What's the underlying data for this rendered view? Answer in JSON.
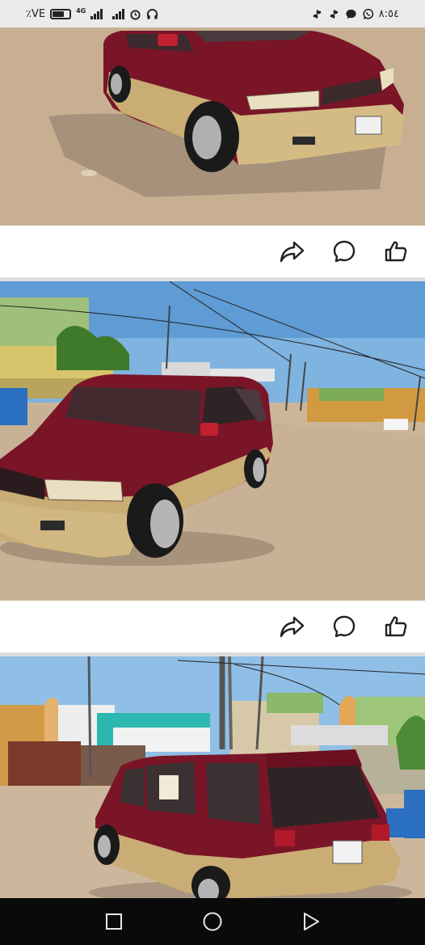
{
  "status_bar": {
    "battery_text": "٪VE",
    "battery_level": 0.74,
    "network_label": "4G",
    "time": "٨:٥٤"
  },
  "posts": [
    {
      "image": "maroon-minivan-front-right-dirt-lot",
      "actions": [
        "share-icon",
        "comment-icon",
        "like-icon"
      ]
    },
    {
      "image": "maroon-minivan-front-left-street",
      "actions": [
        "share-icon",
        "comment-icon",
        "like-icon"
      ]
    },
    {
      "image": "maroon-minivan-rear-houses",
      "actions": []
    }
  ],
  "colors": {
    "car_maroon": "#7a1528",
    "car_gold": "#c9ad74",
    "sky": "#8fbfe6",
    "dirt": "#cbb396",
    "status_bg": "#ebebeb",
    "nav_bg": "#0a0a0a"
  },
  "nav": {
    "icons": [
      "recents-icon",
      "home-icon",
      "back-icon"
    ]
  }
}
